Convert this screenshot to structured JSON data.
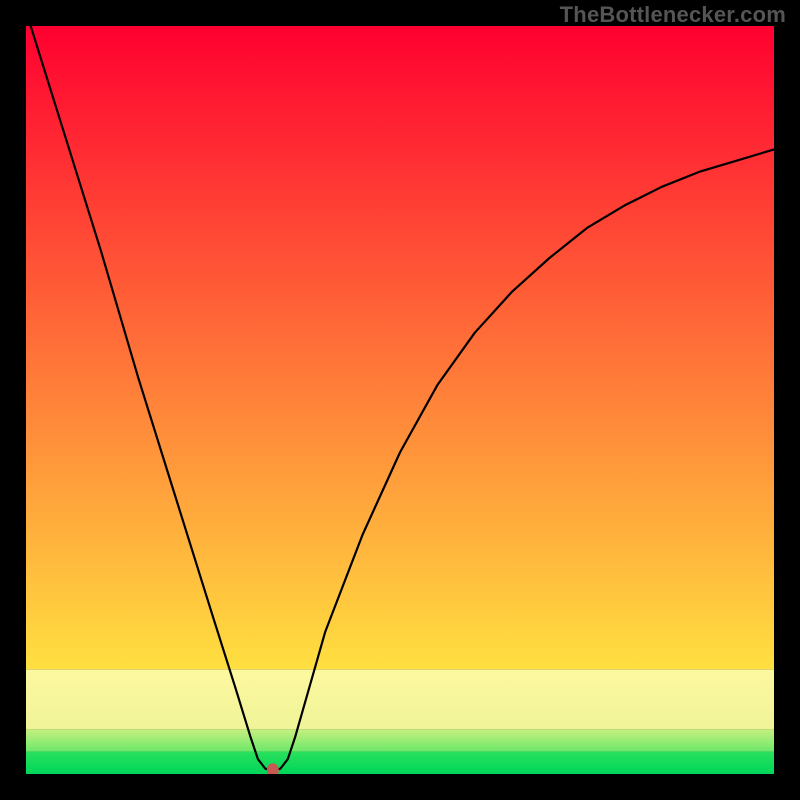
{
  "attribution": "TheBottlenecker.com",
  "chart_data": {
    "type": "line",
    "title": "",
    "xlabel": "",
    "ylabel": "",
    "xlim": [
      0,
      100
    ],
    "ylim": [
      0,
      100
    ],
    "x": [
      0,
      5,
      10,
      15,
      20,
      25,
      28,
      30,
      31,
      32,
      33,
      34,
      35,
      36,
      38,
      40,
      45,
      50,
      55,
      60,
      65,
      70,
      75,
      80,
      85,
      90,
      95,
      100
    ],
    "values": [
      102,
      86,
      70,
      53,
      37,
      21,
      11.5,
      5,
      2,
      0.7,
      0.5,
      0.7,
      2,
      5,
      12,
      19,
      32,
      43,
      52,
      59,
      64.5,
      69,
      73,
      76,
      78.5,
      80.5,
      82,
      83.5
    ],
    "marker": {
      "x": 33,
      "y": 0.5
    },
    "bands": [
      {
        "name": "green-band",
        "y0": 0,
        "y1": 3,
        "color_top": "#2ae05c",
        "color_bottom": "#00d65a"
      },
      {
        "name": "pale-green-band",
        "y0": 3,
        "y1": 6,
        "color_top": "#c8f080",
        "color_bottom": "#6be86a"
      },
      {
        "name": "pale-yellow-band",
        "y0": 6,
        "y1": 14,
        "color_top": "#fdf8a0",
        "color_bottom": "#f0f498"
      },
      {
        "name": "gradient-band",
        "y0": 14,
        "y1": 100,
        "color_top": "#ff0030",
        "color_bottom": "#ffe040"
      }
    ],
    "line_style": {
      "stroke": "#000000",
      "width": 2.2
    },
    "marker_style": {
      "fill": "#c85a54",
      "rx": 6,
      "ry": 7
    }
  }
}
